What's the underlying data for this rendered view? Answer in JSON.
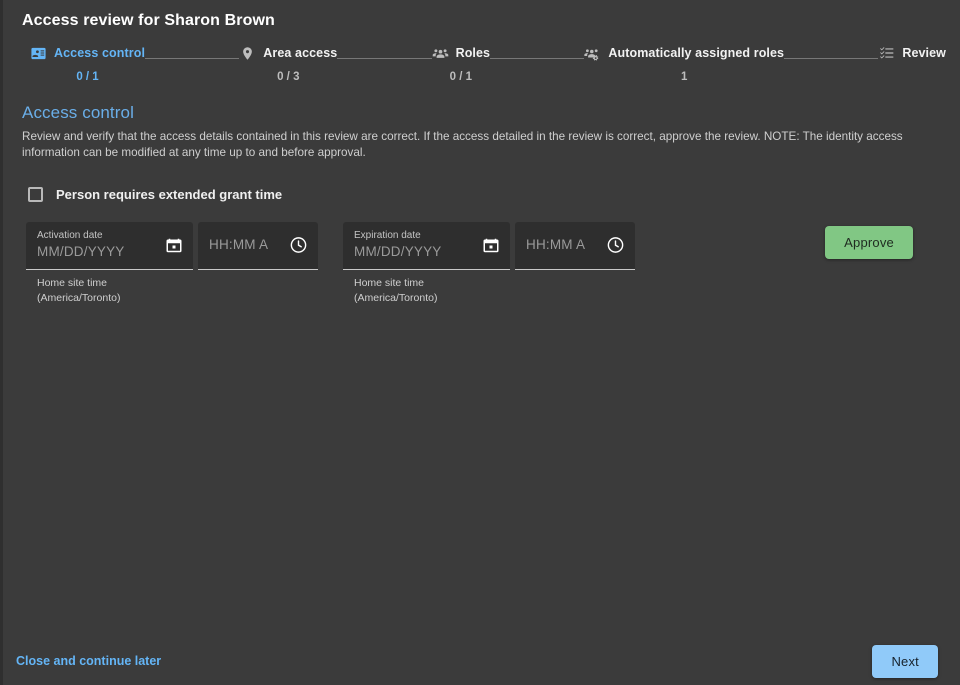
{
  "header": {
    "title": "Access review for Sharon Brown"
  },
  "stepper": {
    "steps": [
      {
        "label": "Access control",
        "count": "0 / 1",
        "icon": "badge-icon",
        "active": true
      },
      {
        "label": "Area access",
        "count": "0 / 3",
        "icon": "location-pin-icon",
        "active": false
      },
      {
        "label": "Roles",
        "count": "0 / 1",
        "icon": "group-icon",
        "active": false
      },
      {
        "label": "Automatically assigned roles",
        "count": "1",
        "icon": "group-gear-icon",
        "active": false
      },
      {
        "label": "Review",
        "count": "",
        "icon": "checklist-icon",
        "active": false
      }
    ]
  },
  "main": {
    "section_title": "Access control",
    "section_description": "Review and verify that the access details contained in this review are correct. If the access detailed in the review is correct, approve the review. NOTE: The identity access information can be modified at any time up to and before approval.",
    "checkbox": {
      "label": "Person requires extended grant time",
      "checked": false
    },
    "activation": {
      "date_label": "Activation date",
      "date_placeholder": "MM/DD/YYYY",
      "date_value": "",
      "time_placeholder": "HH:MM A",
      "time_value": "",
      "helper_line1": "Home site time",
      "helper_line2": "(America/Toronto)",
      "date_icon": "calendar-icon",
      "time_icon": "clock-icon"
    },
    "expiration": {
      "date_label": "Expiration date",
      "date_placeholder": "MM/DD/YYYY",
      "date_value": "",
      "time_placeholder": "HH:MM A",
      "time_value": "",
      "helper_line1": "Home site time",
      "helper_line2": "(America/Toronto)",
      "date_icon": "calendar-icon",
      "time_icon": "clock-icon"
    },
    "approve_label": "Approve"
  },
  "footer": {
    "close_label": "Close and continue later",
    "next_label": "Next"
  },
  "colors": {
    "background": "#3b3b3b",
    "field_background": "#2e2e2e",
    "accent_blue": "#64b5f6",
    "section_title_blue": "#6aaee8",
    "approve_green": "#81c784",
    "next_blue": "#90caf9"
  }
}
